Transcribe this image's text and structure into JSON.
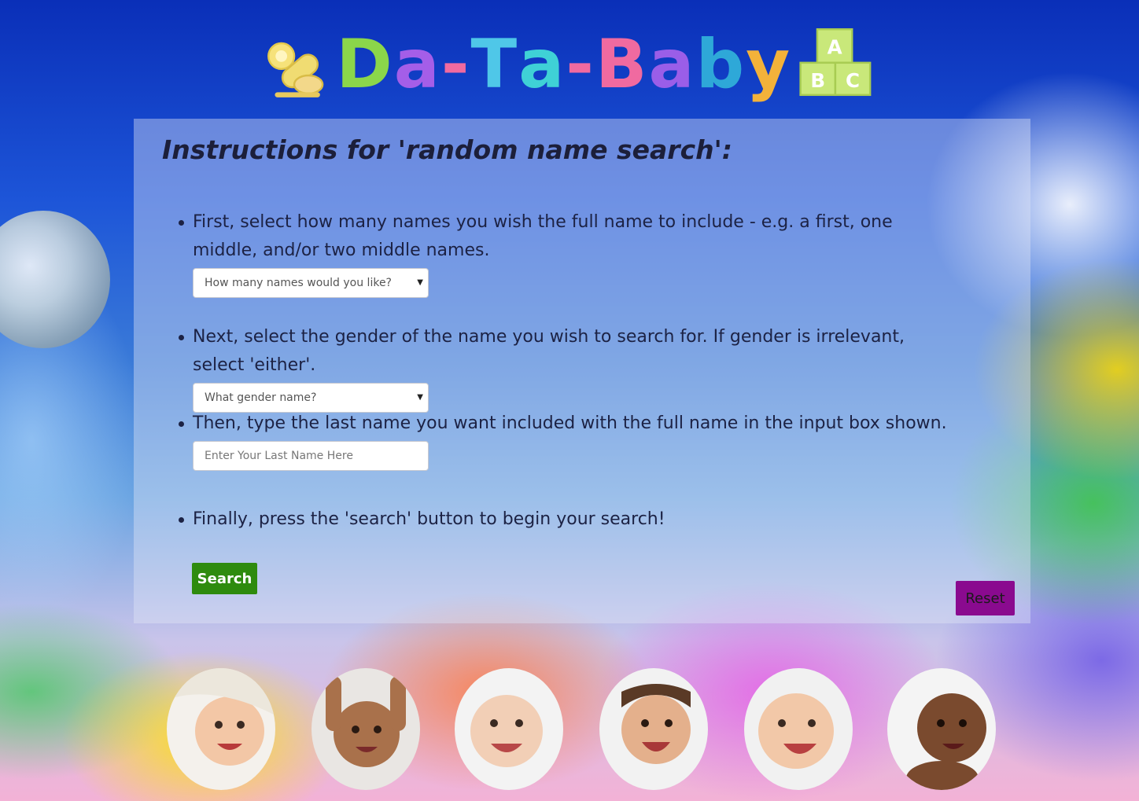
{
  "header": {
    "logo_text": [
      "D",
      "a",
      "-",
      "T",
      "a",
      "-",
      "B",
      "a",
      "b",
      "y"
    ],
    "logo_colors": [
      "#8bd64a",
      "#a45ee8",
      "#f06aa0",
      "#4fc7e8",
      "#3fd1d6",
      "#f06aa0",
      "#f06aa0",
      "#9a5ee8",
      "#2ea8d8",
      "#f3b23a"
    ],
    "blocks_letters": [
      "A",
      "B",
      "C"
    ]
  },
  "instructions": {
    "title": "Instructions for 'random name search':",
    "steps": [
      {
        "text": "First, select how many names you wish the full name to include - e.g. a first, one middle, and/or two middle names.",
        "control_value": "How many names would you like?"
      },
      {
        "text": "Next, select the gender of the name you wish to search for. If gender is irrelevant, select 'either'.",
        "control_value": "What gender name?"
      },
      {
        "text": "Then, type the last name you want included with the full name in the input box shown.",
        "control_placeholder": "Enter Your Last Name Here"
      },
      {
        "text": "Finally, press the 'search' button to begin your search!"
      }
    ]
  },
  "buttons": {
    "search_label": "Search",
    "reset_label": "Reset"
  },
  "colors": {
    "search_button": "#2e8b0e",
    "reset_button": "#8a0a8f"
  },
  "babies": [
    {
      "name": "baby-photo"
    },
    {
      "name": "baby-photo"
    },
    {
      "name": "baby-photo"
    },
    {
      "name": "baby-photo"
    },
    {
      "name": "baby-photo"
    },
    {
      "name": "baby-photo"
    }
  ]
}
